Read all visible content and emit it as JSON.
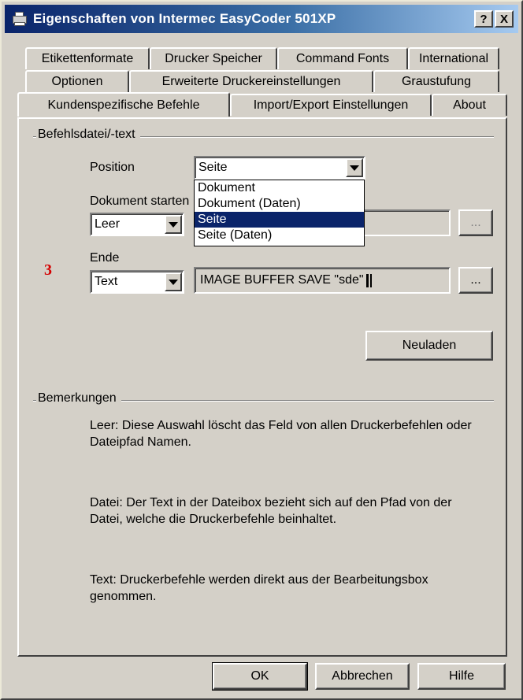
{
  "window": {
    "title": "Eigenschaften von Intermec EasyCoder 501XP",
    "help_label": "?",
    "close_label": "X"
  },
  "tabs": {
    "row1": [
      "Etikettenformate",
      "Drucker Speicher",
      "Command Fonts",
      "International"
    ],
    "row2": [
      "Optionen",
      "Erweiterte Druckereinstellungen",
      "Graustufung"
    ],
    "row3": [
      "Kundenspezifische Befehle",
      "Import/Export Einstellungen",
      "About"
    ],
    "active": "Kundenspezifische Befehle"
  },
  "command_group": {
    "label": "Befehlsdatei/-text",
    "position_label": "Position",
    "position_value": "Seite",
    "position_options": [
      "Dokument",
      "Dokument (Daten)",
      "Seite",
      "Seite (Daten)"
    ],
    "position_selected_option": "Seite",
    "start_label": "Dokument starten",
    "start_type": "Leer",
    "start_text": "",
    "browse_label": "...",
    "end_label": "Ende",
    "end_type": "Text",
    "end_text": "IMAGE BUFFER SAVE \"sde\"",
    "reload_label": "Neuladen",
    "annotation": "3"
  },
  "remarks_group": {
    "label": "Bemerkungen",
    "leer": "Leer: Diese Auswahl löscht das Feld von allen Druckerbefehlen oder Dateipfad Namen.",
    "datei": "Datei: Der Text in der Dateibox bezieht sich auf den Pfad von der Datei, welche die Druckerbefehle beinhaltet.",
    "text": "Text: Druckerbefehle werden direkt aus der Bearbeitungsbox genommen."
  },
  "footer": {
    "ok_label": "OK",
    "cancel_label": "Abbrechen",
    "help_label": "Hilfe"
  }
}
